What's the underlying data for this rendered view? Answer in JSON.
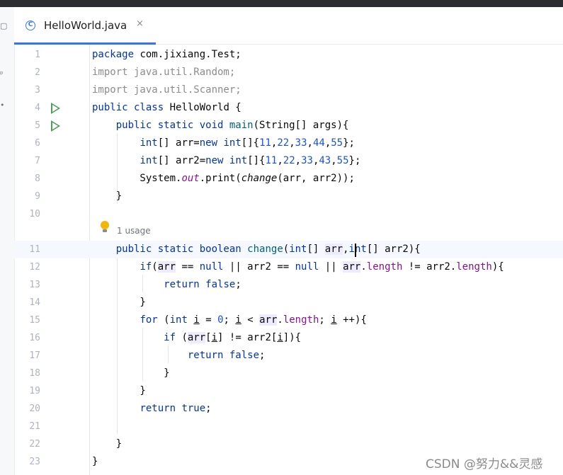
{
  "tab": {
    "icon": "class-icon",
    "icon_glyph": "C",
    "title": "HelloWorld.java",
    "close_glyph": "×"
  },
  "left_strip": {
    "icons": [
      "project-icon",
      "structure-icon",
      "more-icon"
    ]
  },
  "editor": {
    "line_numbers": [
      "1",
      "2",
      "3",
      "4",
      "5",
      "6",
      "7",
      "8",
      "9",
      "10",
      "11",
      "12",
      "13",
      "14",
      "15",
      "16",
      "17",
      "18",
      "19",
      "20",
      "21",
      "22",
      "23"
    ],
    "run_gutter_lines": [
      4,
      5
    ],
    "current_line": 11,
    "inlay_hint": {
      "icon": "lightbulb-icon",
      "text": "1 usage"
    },
    "code": {
      "l1": [
        "package",
        " com.jixiang.Test;"
      ],
      "l2": [
        "import java.util.Random;"
      ],
      "l3": [
        "import java.util.Scanner;"
      ],
      "l4": [
        "public class",
        " HelloWorld {"
      ],
      "l5": [
        "    ",
        "public static void",
        " ",
        "main",
        "(String[] args){"
      ],
      "l6": [
        "        ",
        "int",
        "[] arr=",
        "new int",
        "[]{",
        "11",
        ",",
        "22",
        ",",
        "33",
        ",",
        "44",
        ",",
        "55",
        "};"
      ],
      "l7": [
        "        ",
        "int",
        "[] arr2=",
        "new int",
        "[]{",
        "11",
        ",",
        "22",
        ",",
        "33",
        ",",
        "43",
        ",",
        "55",
        "};"
      ],
      "l8": [
        "        System.",
        "out",
        ".print(",
        "change",
        "(arr, arr2));"
      ],
      "l9": [
        "    }"
      ],
      "l11": [
        "    ",
        "public static boolean",
        " ",
        "change",
        "(",
        "int",
        "[] ",
        "arr",
        ",",
        "int",
        "[] arr2){"
      ],
      "l12": [
        "        ",
        "if",
        "(",
        "arr",
        " == ",
        "null",
        " || arr2 == ",
        "null",
        " || ",
        "arr",
        ".",
        "length",
        " != arr2.",
        "length",
        "){"
      ],
      "l13": [
        "            ",
        "return false",
        ";"
      ],
      "l14": [
        "        }"
      ],
      "l15": [
        "        ",
        "for",
        " (",
        "int",
        " ",
        "i",
        " = ",
        "0",
        "; ",
        "i",
        " < ",
        "arr",
        ".",
        "length",
        "; ",
        "i",
        " ++){"
      ],
      "l16": [
        "            ",
        "if",
        " (",
        "arr",
        "[",
        "i",
        "] != arr2[",
        "i",
        "]){"
      ],
      "l17": [
        "                ",
        "return false",
        ";"
      ],
      "l18": [
        "            }"
      ],
      "l19": [
        "        }"
      ],
      "l20": [
        "        ",
        "return true",
        ";"
      ],
      "l22": [
        "    }"
      ],
      "l23": [
        "}"
      ]
    }
  },
  "watermark": "CSDN @努力&&灵感",
  "colors": {
    "keyword": "#0033b3",
    "number": "#1750eb",
    "field": "#871094",
    "method": "#00627a",
    "run_icon": "#4aa05a",
    "tab_accent": "#3574f0",
    "current_line": "#f5f8fe"
  }
}
